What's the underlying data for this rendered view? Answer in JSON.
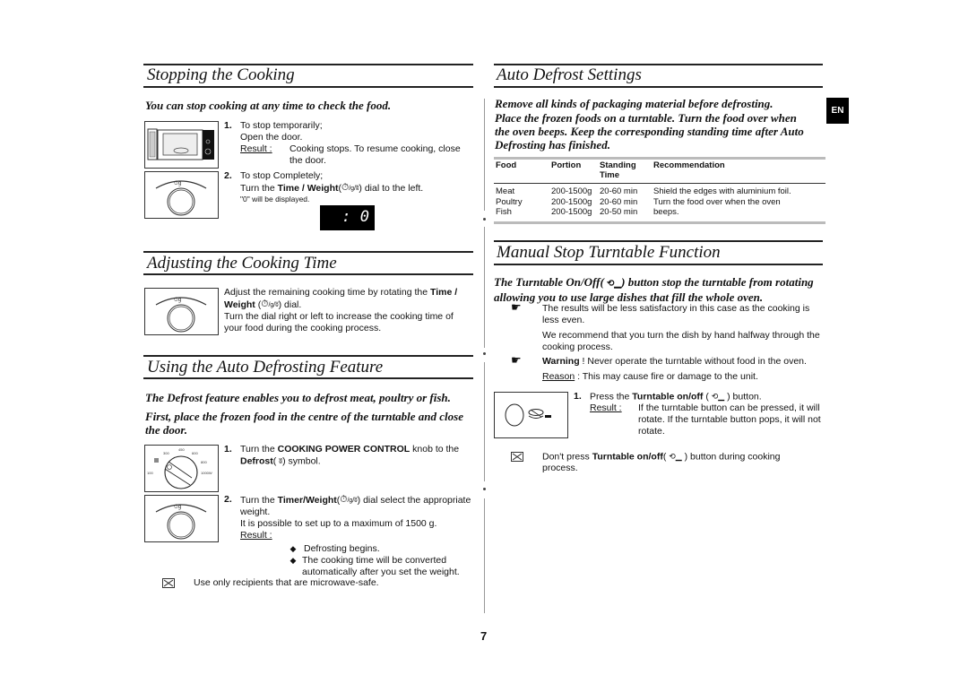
{
  "page_number": "7",
  "language_tab": "EN",
  "left": {
    "stopping": {
      "title": "Stopping the Cooking",
      "intro": "You can stop cooking at any time to check the food.",
      "step1": {
        "num": "1.",
        "line1": "To stop temporarily;",
        "line2": "Open the door.",
        "result_label": "Result :",
        "result_text": "Cooking stops. To resume cooking, close the door."
      },
      "step2": {
        "num": "2.",
        "line1": "To stop Completely;",
        "line2_pre": "Turn the ",
        "line2_bold": "Time / Weight",
        "line2_post": ") dial to the left.",
        "note": "\"0\" will be displayed."
      },
      "display_value": ":  0"
    },
    "adjusting": {
      "title": "Adjusting the Cooking Time",
      "text_pre": "Adjust the remaining cooking time by rotating the ",
      "text_bold": "Time / Weight",
      "text_post": ") dial.",
      "text2": "Turn the dial right or left to increase the cooking time of your food during the cooking process."
    },
    "auto_defrost": {
      "title": "Using the Auto Defrosting Feature",
      "intro1": "The Defrost feature enables you to defrost meat, poultry or fish.",
      "intro2": "First, place the frozen food in the centre of the turntable and close the door.",
      "step1": {
        "num": "1.",
        "pre": "Turn the ",
        "bold": "COOKING POWER CONTROL",
        "post": " knob to the",
        "bold2": "Defrost",
        "post2": ") symbol."
      },
      "dial_labels": [
        "100",
        "300",
        "450",
        "600",
        "800",
        "1000W"
      ],
      "step2": {
        "num": "2.",
        "pre": "Turn the ",
        "bold": "Timer/Weight",
        "post": ") dial select the appropriate weight.",
        "line2": "It is possible to set up to a maximum of 1500 g.",
        "result_label": "Result :",
        "bullets": [
          "Defrosting begins.",
          "The cooking time will be converted automatically after you set the weight."
        ]
      },
      "note": "Use only recipients that are microwave-safe."
    }
  },
  "right": {
    "auto_defrost_settings": {
      "title": "Auto Defrost Settings",
      "intro1": "Remove all kinds of packaging material before defrosting.",
      "intro2": "Place the frozen foods on a turntable. Turn the food over when the oven beeps. Keep the corresponding standing time after Auto Defrosting has finished.",
      "table": {
        "headers": [
          "Food",
          "Portion",
          "Standing Time",
          "Recommendation"
        ],
        "rows": [
          [
            "Meat",
            "200-1500g",
            "20-60 min",
            "Shield the edges with aluminium foil."
          ],
          [
            "Poultry",
            "200-1500g",
            "20-60 min",
            "Turn the food over when the oven"
          ],
          [
            "Fish",
            "200-1500g",
            "20-50 min",
            "beeps."
          ]
        ]
      }
    },
    "manual_stop": {
      "title": "Manual Stop Turntable Function",
      "intro_pre": "The Turntable On/Off(",
      "intro_post": ") button stop the turntable from rotating allowing you to use large dishes that fill the whole oven.",
      "bullet1_a": "The results will be less satisfactory in this case as the cooking is less even.",
      "bullet1_b": "We recommend that you turn the dish by hand halfway through the cooking process.",
      "bullet2_bold": "Warning",
      "bullet2_text": " ! Never operate the turntable without food in the oven.",
      "reason_label": "Reason",
      "reason_text": " : This may cause fire or damage to the unit.",
      "step1": {
        "num": "1.",
        "pre": "Press the ",
        "bold": "Turntable on/off",
        "post": ") button.",
        "result_label": "Result :",
        "result_text": "If the turntable button can be pressed, it will rotate. If the turntable button pops, it will not rotate."
      },
      "note_pre": "Don't press ",
      "note_bold": "Turntable on/off",
      "note_post": ") button during cooking process."
    }
  }
}
